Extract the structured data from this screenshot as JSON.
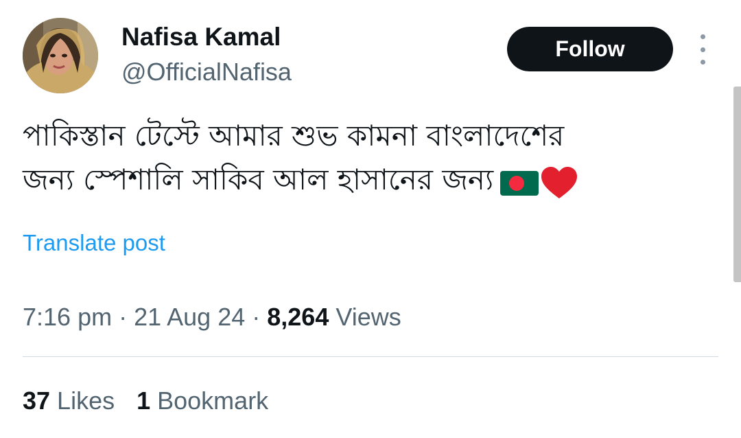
{
  "author": {
    "display_name": "Nafisa Kamal",
    "handle": "@OfficialNafisa",
    "avatar_icon": "profile-photo"
  },
  "actions": {
    "follow_label": "Follow",
    "more_icon": "more-vertical-icon"
  },
  "tweet": {
    "line1": "পাকিস্তান টেস্টে আমার শুভ কামনা বাংলাদেশের",
    "line2": "জন্য স্পেশালি সাকিব আল হাসানের জন্য",
    "emojis": [
      "bangladesh-flag",
      "red-heart"
    ]
  },
  "translate_label": "Translate post",
  "meta": {
    "time": "7:16 pm",
    "separator": " · ",
    "date": "21 Aug 24",
    "views_count": "8,264",
    "views_label": " Views"
  },
  "stats": {
    "likes_count": "37",
    "likes_label": " Likes",
    "bookmarks_count": "1",
    "bookmarks_label": " Bookmark"
  },
  "colors": {
    "accent": "#1d9bf0",
    "text_primary": "#0f1419",
    "text_secondary": "#536471",
    "follow_bg": "#0f1419"
  }
}
